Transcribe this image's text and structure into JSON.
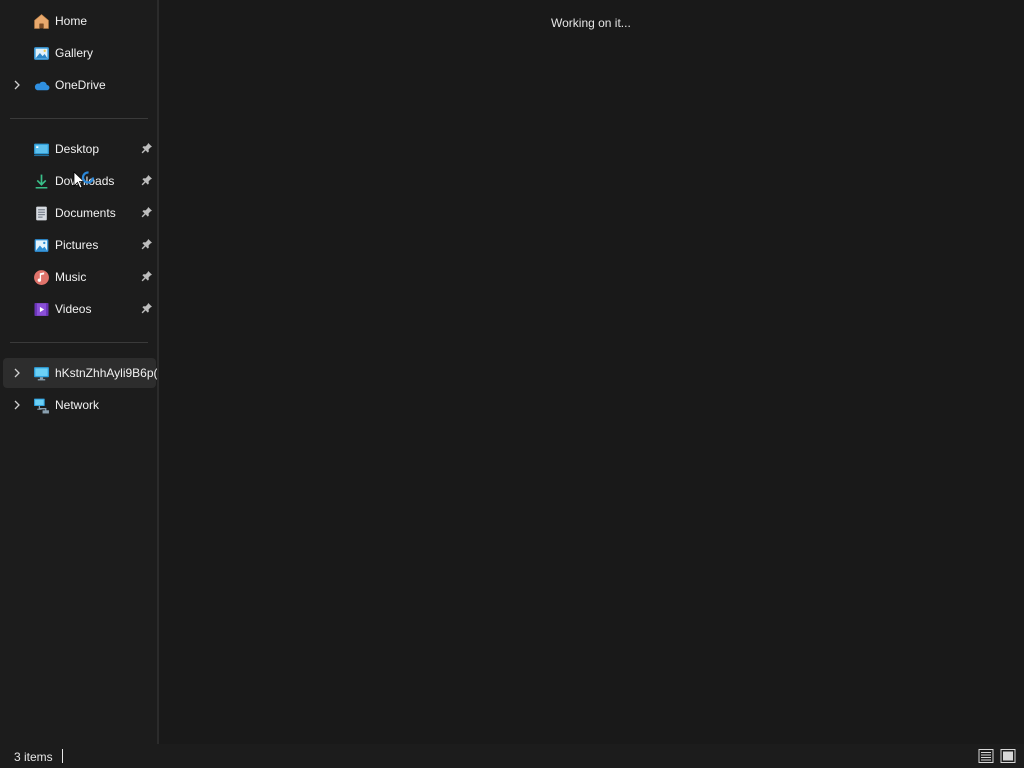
{
  "sidebar": {
    "top_items": [
      {
        "label": "Home",
        "icon": "home-icon"
      },
      {
        "label": "Gallery",
        "icon": "gallery-icon"
      },
      {
        "label": "OneDrive",
        "icon": "onedrive-icon"
      }
    ],
    "quick_access": [
      {
        "label": "Desktop",
        "icon": "desktop-folder-icon"
      },
      {
        "label": "Downloads",
        "icon": "downloads-icon"
      },
      {
        "label": "Documents",
        "icon": "documents-icon"
      },
      {
        "label": "Pictures",
        "icon": "pictures-icon"
      },
      {
        "label": "Music",
        "icon": "music-icon"
      },
      {
        "label": "Videos",
        "icon": "videos-icon"
      }
    ],
    "devices": [
      {
        "label": "hKstnZhhAyli9B6p(",
        "icon": "this-pc-icon"
      },
      {
        "label": "Network",
        "icon": "network-icon"
      }
    ]
  },
  "content": {
    "status_message": "Working on it..."
  },
  "statusbar": {
    "item_count": "3 items"
  },
  "colors": {
    "background": "#191919",
    "sidebar": "#1c1c1c",
    "selected": "#2d2d2d",
    "accent": "#0078d4"
  }
}
